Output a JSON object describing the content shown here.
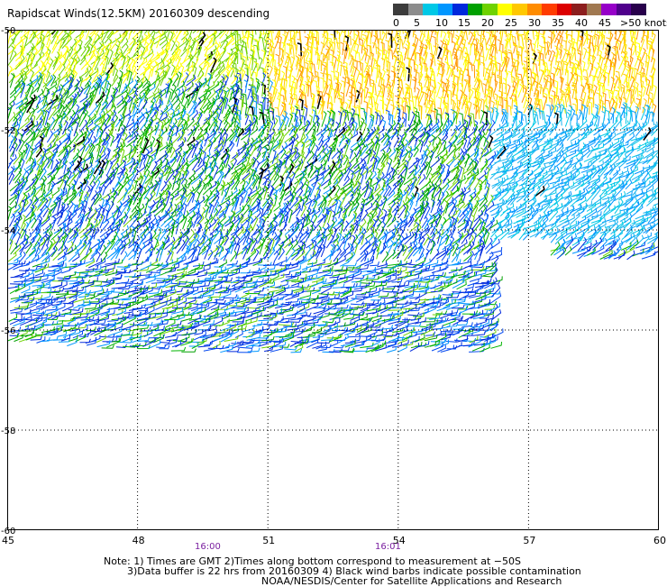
{
  "title": "Rapidscat Winds(12.5KM) 20160309 descending",
  "legend": {
    "labels": [
      "0",
      "5",
      "10",
      "15",
      "20",
      "25",
      "30",
      "35",
      "40",
      "45",
      ">50 knots"
    ],
    "colors": [
      "#3c3c3c",
      "#8c8c8c",
      "#00c8e6",
      "#0096ff",
      "#0028dc",
      "#00a000",
      "#6ed200",
      "#ffff00",
      "#ffc800",
      "#ff8c00",
      "#ff3c00",
      "#dc0000",
      "#8c1e1e",
      "#a07850",
      "#9600c8",
      "#50008c",
      "#28004b"
    ]
  },
  "map": {
    "lat_labels": [
      "-50",
      "-52",
      "-54",
      "-56",
      "-58",
      "-60"
    ],
    "lon_labels": [
      "45",
      "48",
      "51",
      "54",
      "57",
      "60"
    ],
    "pass_times": [
      "16:00",
      "16:01"
    ],
    "wind_color_regions": {
      "north_yellow_band": [
        "#ffff00",
        "#ffe100",
        "#ffc800",
        "#ff9600"
      ],
      "central_green": [
        "#00a000",
        "#6ed200",
        "#00b400"
      ],
      "southern_blue": [
        "#0028dc",
        "#0046f0",
        "#0096ff"
      ],
      "east_cyan": [
        "#00c8e6",
        "#19b4f0",
        "#0096ff"
      ],
      "contamination": "#000000"
    }
  },
  "notes": {
    "line1": "Note: 1) Times are GMT 2)Times along bottom correspond to measurement at −50S",
    "line2": "3)Data buffer is 22 hrs from 20160309 4) Black wind barbs indicate possible contamination",
    "line3": "NOAA/NESDIS/Center for Satellite Applications and Research"
  }
}
